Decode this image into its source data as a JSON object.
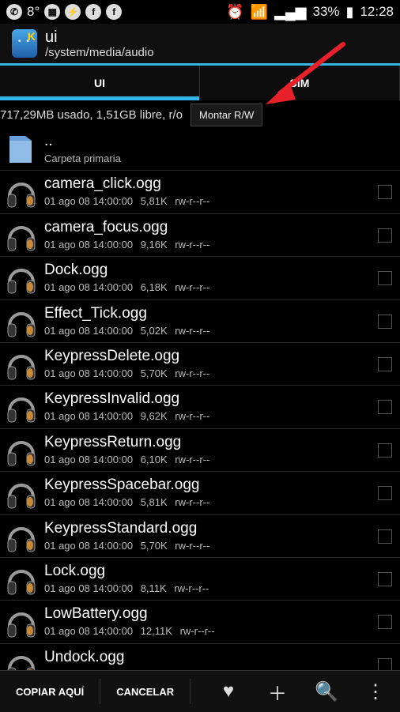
{
  "status_bar": {
    "temperature": "8°",
    "battery": "33%",
    "time": "12:28",
    "left_icons": [
      "whatsapp-icon",
      "calendar-icon",
      "messenger-icon",
      "facebook-icon",
      "facebook-icon"
    ],
    "right_icons": [
      "alarm-icon",
      "wifi-icon",
      "signal-icon",
      "battery-icon"
    ]
  },
  "header": {
    "title": "ui",
    "path": "/system/media/audio"
  },
  "tabs": [
    {
      "label": "UI"
    },
    {
      "label": "SIM"
    }
  ],
  "storage": {
    "text": "717,29MB usado, 1,51GB libre, r/o",
    "mount_button": "Montar R/W"
  },
  "folder": {
    "name": "..",
    "label": "Carpeta primaria"
  },
  "files": [
    {
      "name": "camera_click.ogg",
      "date": "01 ago 08 14:00:00",
      "size": "5,81K",
      "perm": "rw-r--r--"
    },
    {
      "name": "camera_focus.ogg",
      "date": "01 ago 08 14:00:00",
      "size": "9,16K",
      "perm": "rw-r--r--"
    },
    {
      "name": "Dock.ogg",
      "date": "01 ago 08 14:00:00",
      "size": "6,18K",
      "perm": "rw-r--r--"
    },
    {
      "name": "Effect_Tick.ogg",
      "date": "01 ago 08 14:00:00",
      "size": "5,02K",
      "perm": "rw-r--r--"
    },
    {
      "name": "KeypressDelete.ogg",
      "date": "01 ago 08 14:00:00",
      "size": "5,70K",
      "perm": "rw-r--r--"
    },
    {
      "name": "KeypressInvalid.ogg",
      "date": "01 ago 08 14:00:00",
      "size": "9,62K",
      "perm": "rw-r--r--"
    },
    {
      "name": "KeypressReturn.ogg",
      "date": "01 ago 08 14:00:00",
      "size": "6,10K",
      "perm": "rw-r--r--"
    },
    {
      "name": "KeypressSpacebar.ogg",
      "date": "01 ago 08 14:00:00",
      "size": "5,81K",
      "perm": "rw-r--r--"
    },
    {
      "name": "KeypressStandard.ogg",
      "date": "01 ago 08 14:00:00",
      "size": "5,70K",
      "perm": "rw-r--r--"
    },
    {
      "name": "Lock.ogg",
      "date": "01 ago 08 14:00:00",
      "size": "8,11K",
      "perm": "rw-r--r--"
    },
    {
      "name": "LowBattery.ogg",
      "date": "01 ago 08 14:00:00",
      "size": "12,11K",
      "perm": "rw-r--r--"
    },
    {
      "name": "Undock.ogg",
      "date": "",
      "size": "",
      "perm": ""
    }
  ],
  "bottom_bar": {
    "copy_here": "COPIAR AQUÍ",
    "cancel": "CANCELAR",
    "icons": [
      "heart-icon",
      "plus-icon",
      "search-icon",
      "overflow-menu-icon"
    ]
  },
  "colors": {
    "accent": "#33b5e5",
    "annotation_arrow": "#e8202a"
  }
}
